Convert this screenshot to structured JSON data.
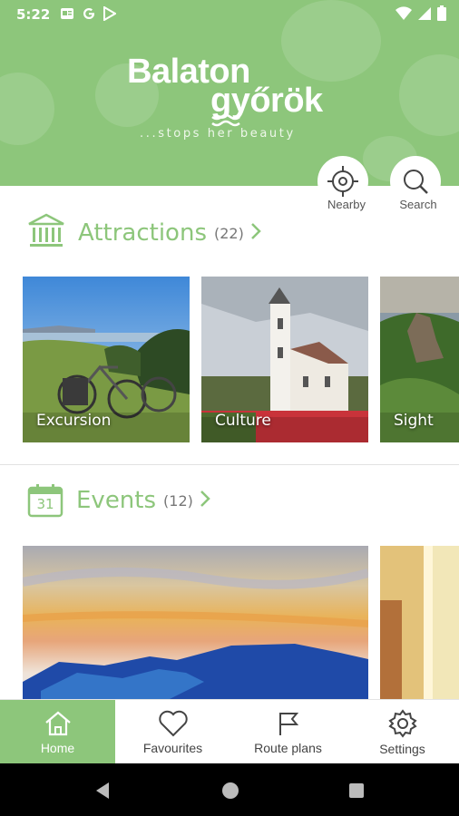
{
  "status_bar": {
    "time": "5:22",
    "left_icons": [
      "news-icon",
      "google-icon",
      "play-store-icon"
    ],
    "right_icons": [
      "wifi-icon",
      "signal-icon",
      "battery-icon"
    ]
  },
  "logo": {
    "line1": "Balaton",
    "line2": "győrök",
    "tagline": "...stops her beauty"
  },
  "quick_actions": [
    {
      "label": "Nearby",
      "icon": "crosshair-icon"
    },
    {
      "label": "Search",
      "icon": "search-icon"
    }
  ],
  "attractions": {
    "title": "Attractions",
    "count": "(22)",
    "icon": "museum-icon",
    "cards": [
      {
        "label": "Excursion"
      },
      {
        "label": "Culture"
      },
      {
        "label": "Sight"
      }
    ]
  },
  "events": {
    "title": "Events",
    "count": "(12)",
    "icon": "calendar-icon",
    "calendar_day": "31"
  },
  "bottom_nav": [
    {
      "label": "Home",
      "icon": "home-icon",
      "active": true
    },
    {
      "label": "Favourites",
      "icon": "heart-icon",
      "active": false
    },
    {
      "label": "Route plans",
      "icon": "flag-icon",
      "active": false
    },
    {
      "label": "Settings",
      "icon": "gear-icon",
      "active": false
    }
  ],
  "colors": {
    "brand_green": "#8dc67b",
    "header_bg": "#8dc67b",
    "text_gray": "#777777"
  }
}
